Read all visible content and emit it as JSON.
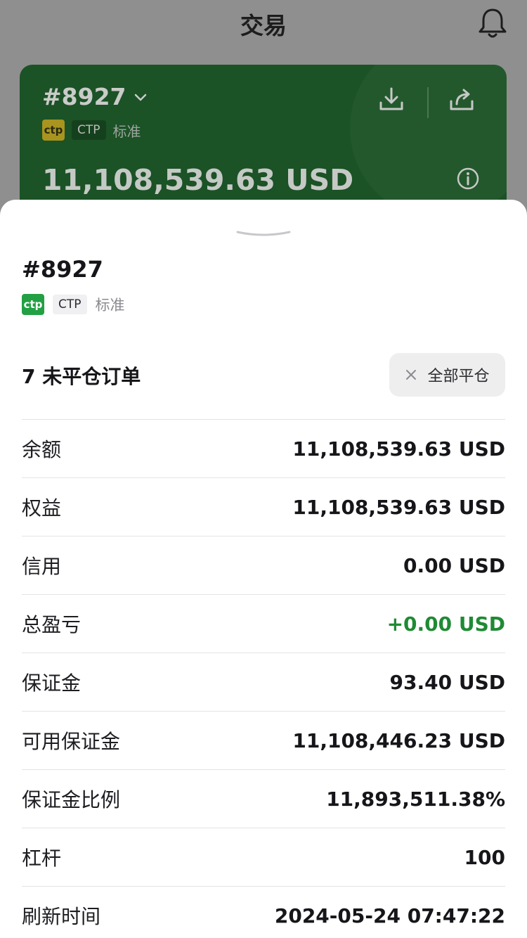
{
  "header": {
    "title": "交易"
  },
  "card": {
    "account": "#8927",
    "logo": "ctp",
    "platform": "CTP",
    "type": "标准",
    "balance": "11,108,539.63 USD"
  },
  "sheet": {
    "account": "#8927",
    "logo": "ctp",
    "platform": "CTP",
    "type": "标准",
    "orders_title": "7 未平仓订单",
    "close_all_label": "全部平仓",
    "rows": [
      {
        "label": "余额",
        "value": "11,108,539.63 USD"
      },
      {
        "label": "权益",
        "value": "11,108,539.63 USD"
      },
      {
        "label": "信用",
        "value": "0.00 USD"
      },
      {
        "label": "总盈亏",
        "value": "+0.00 USD"
      },
      {
        "label": "保证金",
        "value": "93.40 USD"
      },
      {
        "label": "可用保证金",
        "value": "11,108,446.23 USD"
      },
      {
        "label": "保证金比例",
        "value": "11,893,511.38%"
      },
      {
        "label": "杠杆",
        "value": "100"
      },
      {
        "label": "刷新时间",
        "value": "2024-05-24 07:47:22"
      }
    ]
  },
  "colors": {
    "positive": "#1f8a34",
    "card_bg": "#1b5226",
    "ctp_logo": "#22a043"
  },
  "icons": [
    "bell-icon",
    "chevron-down-icon",
    "download-icon",
    "share-icon",
    "info-icon",
    "close-icon"
  ]
}
